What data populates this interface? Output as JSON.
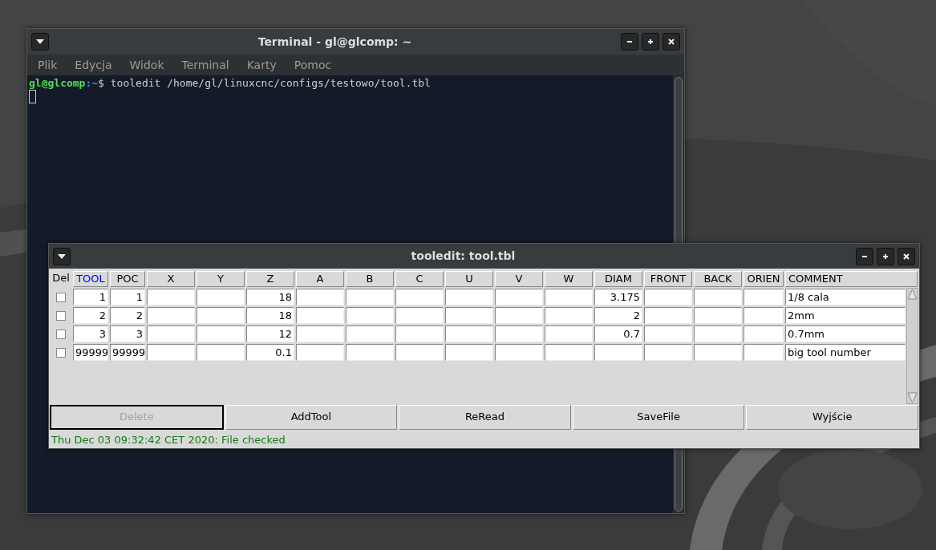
{
  "terminal": {
    "title": "Terminal - gl@glcomp: ~",
    "menu": [
      "Plik",
      "Edycja",
      "Widok",
      "Terminal",
      "Karty",
      "Pomoc"
    ],
    "prompt": {
      "user_host": "gl@glcomp",
      "separator": ":",
      "path": "~",
      "symbol": "$",
      "command": "tooledit /home/gl/linuxcnc/configs/testowo/tool.tbl"
    }
  },
  "tooledit": {
    "title": "tooledit: tool.tbl",
    "columns": [
      {
        "label": "Del",
        "kind": "checkbox",
        "selected": false
      },
      {
        "label": "TOOL",
        "kind": "number",
        "selected": true
      },
      {
        "label": "POC",
        "kind": "number",
        "selected": false
      },
      {
        "label": "X",
        "kind": "number",
        "selected": false
      },
      {
        "label": "Y",
        "kind": "number",
        "selected": false
      },
      {
        "label": "Z",
        "kind": "number",
        "selected": false
      },
      {
        "label": "A",
        "kind": "number",
        "selected": false
      },
      {
        "label": "B",
        "kind": "number",
        "selected": false
      },
      {
        "label": "C",
        "kind": "number",
        "selected": false
      },
      {
        "label": "U",
        "kind": "number",
        "selected": false
      },
      {
        "label": "V",
        "kind": "number",
        "selected": false
      },
      {
        "label": "W",
        "kind": "number",
        "selected": false
      },
      {
        "label": "DIAM",
        "kind": "number",
        "selected": false
      },
      {
        "label": "FRONT",
        "kind": "number",
        "selected": false
      },
      {
        "label": "BACK",
        "kind": "number",
        "selected": false
      },
      {
        "label": "ORIEN",
        "kind": "number",
        "selected": false
      },
      {
        "label": "COMMENT",
        "kind": "text",
        "selected": false
      }
    ],
    "rows": [
      {
        "checked": false,
        "cells": [
          "",
          "1",
          "1",
          "",
          "",
          "18",
          "",
          "",
          "",
          "",
          "",
          "",
          "3.175",
          "",
          "",
          "",
          "1/8 cala"
        ]
      },
      {
        "checked": false,
        "cells": [
          "",
          "2",
          "2",
          "",
          "",
          "18",
          "",
          "",
          "",
          "",
          "",
          "",
          "2",
          "",
          "",
          "",
          "2mm"
        ]
      },
      {
        "checked": false,
        "cells": [
          "",
          "3",
          "3",
          "",
          "",
          "12",
          "",
          "",
          "",
          "",
          "",
          "",
          "0.7",
          "",
          "",
          "",
          "0.7mm"
        ]
      },
      {
        "checked": false,
        "cells": [
          "",
          "99999",
          "99999",
          "",
          "",
          "0.1",
          "",
          "",
          "",
          "",
          "",
          "",
          "",
          "",
          "",
          "",
          "big tool number"
        ]
      }
    ],
    "buttons": [
      {
        "label": "Delete",
        "disabled": true,
        "focused": true
      },
      {
        "label": "AddTool",
        "disabled": false,
        "focused": false
      },
      {
        "label": "ReRead",
        "disabled": false,
        "focused": false
      },
      {
        "label": "SaveFile",
        "disabled": false,
        "focused": false
      },
      {
        "label": "Wyjście",
        "disabled": false,
        "focused": false
      }
    ],
    "status": "Thu Dec 03 09:32:42 CET 2020: File checked"
  }
}
